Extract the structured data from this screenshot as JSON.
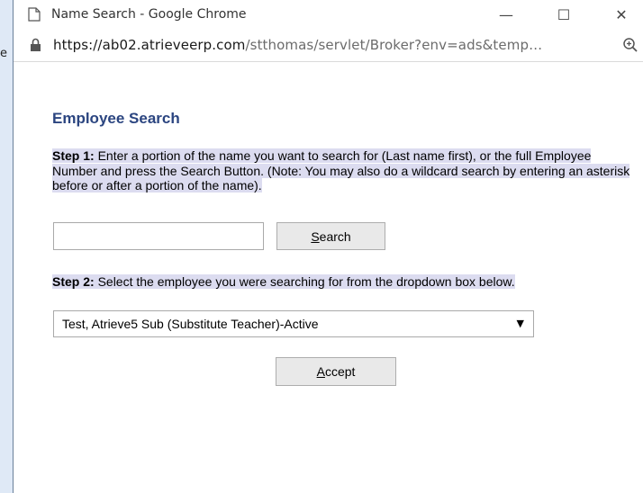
{
  "background": {
    "edge_letter": "e"
  },
  "window": {
    "title": "Name Search - Google Chrome",
    "controls": {
      "minimize": "—",
      "maximize": "☐",
      "close": "✕"
    }
  },
  "urlbar": {
    "host": "https://ab02.atrieveerp.com",
    "path": "/stthomas/servlet/Broker?env=ads&temp…",
    "icons": {
      "lock": "lock-icon",
      "zoom": "zoom-icon"
    }
  },
  "page": {
    "heading": "Employee Search",
    "step1": {
      "label": "Step 1:",
      "text": " Enter a portion of the name you want to search for (Last name first), or the full Employee Number and press the Search Button. (Note: You may also do a wildcard search by entering an asterisk before or after a portion of the name)."
    },
    "search_input": {
      "value": "",
      "placeholder": ""
    },
    "search_button": {
      "accesskey": "S",
      "rest": "earch"
    },
    "step2": {
      "label": "Step 2:",
      "text": " Select the employee you were searching for from the dropdown box below."
    },
    "employee_select": {
      "selected": "Test, Atrieve5 Sub (Substitute Teacher)-Active"
    },
    "accept_button": {
      "accesskey": "A",
      "rest": "ccept"
    }
  },
  "colors": {
    "heading": "#2b4580",
    "highlight": "#dcdcf0",
    "desktop_edge": "#aac4e6"
  }
}
